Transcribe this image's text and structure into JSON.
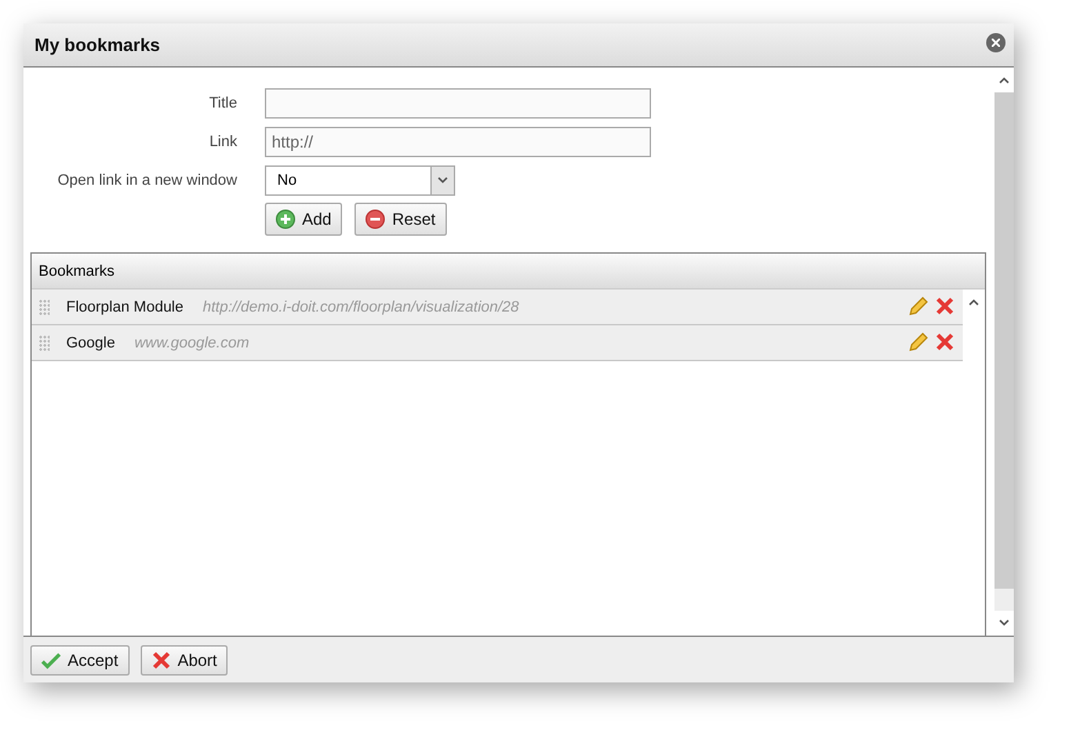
{
  "window": {
    "title": "My bookmarks"
  },
  "form": {
    "fields": [
      {
        "label": "Title",
        "kind": "text"
      },
      {
        "label": "Link",
        "kind": "text",
        "value": "http://"
      },
      {
        "label": "Open link in a new window",
        "kind": "select",
        "value": "No"
      }
    ],
    "buttons": [
      {
        "label": "Add",
        "kind": "add"
      },
      {
        "label": "Reset",
        "kind": "reset"
      }
    ]
  },
  "bookmarks": {
    "header": "Bookmarks",
    "rows": [
      {
        "title": "Floorplan Module",
        "url": "http://demo.i-doit.com/floorplan/visualization/28"
      },
      {
        "title": "Google",
        "url": "www.google.com"
      }
    ]
  },
  "footer": {
    "buttons": [
      {
        "label": "Accept",
        "kind": "accept"
      },
      {
        "label": "Abort",
        "kind": "abort"
      }
    ]
  }
}
